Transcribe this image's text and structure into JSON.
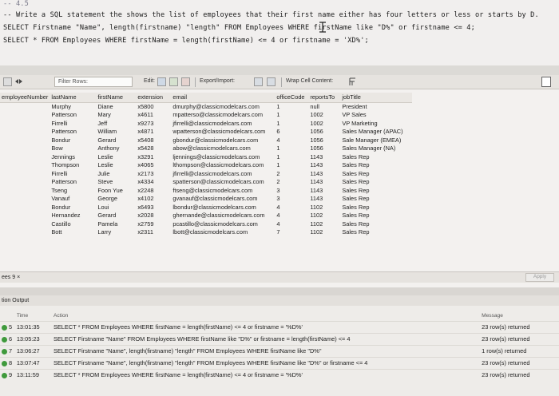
{
  "editor": {
    "line1": "-- 4.5",
    "line2": "-- Write a SQL statement the shows the list of employees that their first name either has four letters or less or starts by D.",
    "line3": "SELECT Firstname \"Name\", length(firstname) \"length\" FROM Employees WHERE firstName like \"D%\" or firstname <= 4;",
    "line4": "SELECT * FROM Employees WHERE firstName = length(firstName) <= 4 or firstname = 'XD%';"
  },
  "toolbar": {
    "filter_label": "Filter Rows:",
    "edit_label": "Edit:",
    "export_label": "Export/Import:",
    "wrap_label": "Wrap Cell Content:"
  },
  "grid": {
    "columns": [
      "employeeNumber",
      "lastName",
      "firstName",
      "extension",
      "email",
      "officeCode",
      "reportsTo",
      "jobTitle"
    ],
    "rows": [
      [
        "",
        "Murphy",
        "Diane",
        "x5800",
        "dmurphy@classicmodelcars.com",
        "1",
        "null",
        "President"
      ],
      [
        "",
        "Patterson",
        "Mary",
        "x4611",
        "mpatterso@classicmodelcars.com",
        "1",
        "1002",
        "VP Sales"
      ],
      [
        "",
        "Firrelli",
        "Jeff",
        "x9273",
        "jfirrelli@classicmodelcars.com",
        "1",
        "1002",
        "VP Marketing"
      ],
      [
        "",
        "Patterson",
        "William",
        "x4871",
        "wpatterson@classicmodelcars.com",
        "6",
        "1056",
        "Sales Manager (APAC)"
      ],
      [
        "",
        "Bondur",
        "Gerard",
        "x5408",
        "gbondur@classicmodelcars.com",
        "4",
        "1056",
        "Sale Manager (EMEA)"
      ],
      [
        "",
        "Bow",
        "Anthony",
        "x5428",
        "abow@classicmodelcars.com",
        "1",
        "1056",
        "Sales Manager (NA)"
      ],
      [
        "",
        "Jennings",
        "Leslie",
        "x3291",
        "ljennings@classicmodelcars.com",
        "1",
        "1143",
        "Sales Rep"
      ],
      [
        "",
        "Thompson",
        "Leslie",
        "x4065",
        "lthompson@classicmodelcars.com",
        "1",
        "1143",
        "Sales Rep"
      ],
      [
        "",
        "Firrelli",
        "Julie",
        "x2173",
        "jfirrelli@classicmodelcars.com",
        "2",
        "1143",
        "Sales Rep"
      ],
      [
        "",
        "Patterson",
        "Steve",
        "x4334",
        "spatterson@classicmodelcars.com",
        "2",
        "1143",
        "Sales Rep"
      ],
      [
        "",
        "Tseng",
        "Foon Yue",
        "x2248",
        "ftseng@classicmodelcars.com",
        "3",
        "1143",
        "Sales Rep"
      ],
      [
        "",
        "Vanauf",
        "George",
        "x4102",
        "gvanauf@classicmodelcars.com",
        "3",
        "1143",
        "Sales Rep"
      ],
      [
        "",
        "Bondur",
        "Loui",
        "x6493",
        "lbondur@classicmodelcars.com",
        "4",
        "1102",
        "Sales Rep"
      ],
      [
        "",
        "Hernandez",
        "Gerard",
        "x2028",
        "ghernande@classicmodelcars.com",
        "4",
        "1102",
        "Sales Rep"
      ],
      [
        "",
        "Castillo",
        "Pamela",
        "x2759",
        "pcastillo@classicmodelcars.com",
        "4",
        "1102",
        "Sales Rep"
      ],
      [
        "",
        "Bott",
        "Larry",
        "x2311",
        "lbott@classicmodelcars.com",
        "7",
        "1102",
        "Sales Rep"
      ]
    ],
    "status_label": "ees 9 ×",
    "apply_label": "Apply"
  },
  "output": {
    "header": "tion Output",
    "columns": [
      "",
      "Time",
      "Action",
      "Message"
    ],
    "rows": [
      {
        "idx": "5",
        "time": "13:01:35",
        "action": "SELECT * FROM Employees WHERE firstName = length(firstName) <= 4 or firstname = '%D%'",
        "message": "23 row(s) returned"
      },
      {
        "idx": "6",
        "time": "13:05:23",
        "action": "SELECT Firstname \"Name\" FROM Employees WHERE firstName like \"D%\" or firstname = length(firstName) <= 4",
        "message": "23 row(s) returned"
      },
      {
        "idx": "7",
        "time": "13:06:27",
        "action": "SELECT Firstname \"Name\", length(firstname) \"length\" FROM Employees WHERE firstName like \"D%\"",
        "message": "1 row(s) returned"
      },
      {
        "idx": "8",
        "time": "13:07:47",
        "action": "SELECT Firstname \"Name\", length(firstname) \"length\" FROM Employees WHERE firstName like \"D%\" or firstname <= 4",
        "message": "23 row(s) returned"
      },
      {
        "idx": "9",
        "time": "13:11:59",
        "action": "SELECT * FROM Employees WHERE firstName = length(firstName) <= 4 or firstname = '%D%'",
        "message": "23 row(s) returned"
      }
    ]
  }
}
